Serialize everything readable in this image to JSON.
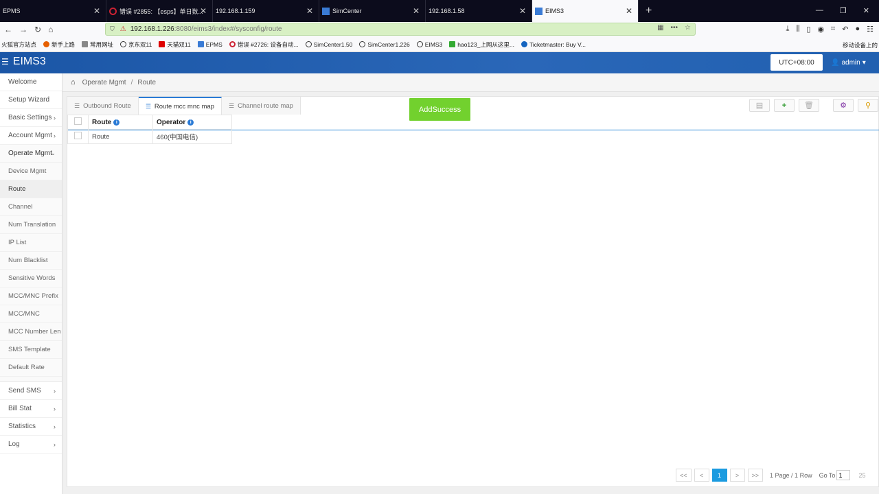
{
  "browser": {
    "tabs": [
      {
        "title": "EPMS",
        "active": false
      },
      {
        "title": "错误 #2855: 【esps】单日数...",
        "active": false
      },
      {
        "title": "192.168.1.159",
        "active": false
      },
      {
        "title": "SimCenter",
        "active": false
      },
      {
        "title": "192.168.1.58",
        "active": false
      },
      {
        "title": "EIMS3",
        "active": true
      }
    ],
    "url_host": "192.168.1.226",
    "url_path": ":8080/eims3/index#/sysconfig/route",
    "bookmarks": [
      "火狐官方站点",
      "新手上路",
      "常用网址",
      "京东双11",
      "天猫双11",
      "EPMS",
      "错误 #2726: 设备自动...",
      "SimCenter1.50",
      "SimCenter1.226",
      "EIMS3",
      "hao123_上网从这里...",
      "Ticketmaster: Buy V..."
    ],
    "bookmarks_right": "移动设备上的"
  },
  "app": {
    "title": "EIMS3",
    "timezone": "UTC+08:00",
    "user": "admin"
  },
  "sidebar": {
    "items_top": [
      {
        "label": "Welcome",
        "arrow": false
      },
      {
        "label": "Setup Wizard",
        "arrow": false
      },
      {
        "label": "Basic Settings",
        "arrow": true
      },
      {
        "label": "Account Mgmt",
        "arrow": true
      },
      {
        "label": "Operate Mgmt",
        "arrow": true
      }
    ],
    "sub_items": [
      {
        "label": "Device Mgmt"
      },
      {
        "label": "Route"
      },
      {
        "label": "Channel"
      },
      {
        "label": "Num Translation"
      },
      {
        "label": "IP List"
      },
      {
        "label": "Num Blacklist"
      },
      {
        "label": "Sensitive Words"
      },
      {
        "label": "MCC/MNC Prefix"
      },
      {
        "label": "MCC/MNC"
      },
      {
        "label": "MCC Number Len"
      },
      {
        "label": "SMS Template"
      },
      {
        "label": "Default Rate"
      }
    ],
    "items_bottom": [
      {
        "label": "Send SMS"
      },
      {
        "label": "Bill Stat"
      },
      {
        "label": "Statistics"
      },
      {
        "label": "Log"
      }
    ]
  },
  "breadcrumb": {
    "parent": "Operate Mgmt",
    "current": "Route"
  },
  "panel_tabs": [
    {
      "label": "Outbound Route",
      "active": false
    },
    {
      "label": "Route mcc mnc map",
      "active": true
    },
    {
      "label": "Channel route map",
      "active": false
    }
  ],
  "toast": "AddSuccess",
  "table": {
    "columns": [
      "Route",
      "Operator"
    ],
    "rows": [
      {
        "route": "Route",
        "operator": "460(中国电信)"
      }
    ]
  },
  "pagination": {
    "first": "<<",
    "prev": "<",
    "current": "1",
    "next": ">",
    "last": ">>",
    "info": "1 Page / 1 Row",
    "goto_label": "Go To",
    "goto_value": "1",
    "page_size": "25"
  },
  "colors": {
    "header": "#1b56a6",
    "toast": "#72d12e",
    "accent": "#1b9be0"
  }
}
